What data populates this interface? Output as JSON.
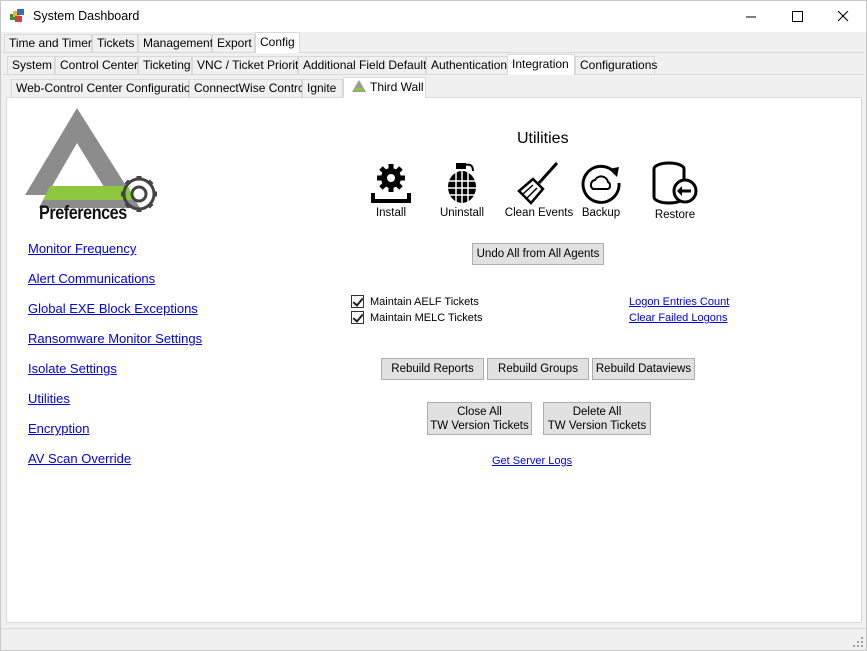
{
  "window": {
    "title": "System Dashboard",
    "controls": [
      "minimize",
      "maximize",
      "close"
    ]
  },
  "tabs_level1": [
    {
      "label": "Time and Timers",
      "active": false
    },
    {
      "label": "Tickets",
      "active": false
    },
    {
      "label": "Management",
      "active": false
    },
    {
      "label": "Export",
      "active": false
    },
    {
      "label": "Config",
      "active": true
    }
  ],
  "tabs_level2": [
    {
      "label": "System",
      "active": false
    },
    {
      "label": "Control Center",
      "active": false
    },
    {
      "label": "Ticketing",
      "active": false
    },
    {
      "label": "VNC / Ticket Priority",
      "active": false
    },
    {
      "label": "Additional Field Defaults",
      "active": false
    },
    {
      "label": "Authentication",
      "active": false
    },
    {
      "label": "Integration",
      "active": true
    },
    {
      "label": "Configurations",
      "active": false
    }
  ],
  "tabs_level3": [
    {
      "label": "Web-Control Center Configuration",
      "active": false
    },
    {
      "label": "ConnectWise Control",
      "active": false
    },
    {
      "label": "Ignite",
      "active": false
    },
    {
      "label": "Third Wall",
      "active": true,
      "icon": "third-wall-logo-icon"
    }
  ],
  "logo": {
    "text": "Preferences",
    "colors": {
      "gray": "#8c8c8c",
      "green": "#8dc63f"
    }
  },
  "nav_links": [
    "Monitor Frequency",
    "Alert Communications",
    "Global EXE Block Exceptions",
    "Ransomware Monitor Settings",
    "Isolate Settings",
    "Utilities",
    "Encryption",
    "AV Scan Override"
  ],
  "utilities": {
    "heading": "Utilities",
    "items": [
      {
        "label": "Install",
        "icon": "install-gear-icon"
      },
      {
        "label": "Uninstall",
        "icon": "grenade-icon"
      },
      {
        "label": "Clean Events",
        "icon": "broom-icon"
      },
      {
        "label": "Backup",
        "icon": "backup-cloud-icon"
      },
      {
        "label": "Restore",
        "icon": "restore-database-icon"
      }
    ],
    "undo_all": "Undo All from All Agents"
  },
  "checkboxes": [
    {
      "label": "Maintain AELF Tickets",
      "checked": true
    },
    {
      "label": "Maintain MELC Tickets",
      "checked": true
    }
  ],
  "links_right": {
    "logon_entries": "Logon Entries Count",
    "clear_failed": "Clear Failed Logons"
  },
  "rebuild_buttons": [
    "Rebuild Reports",
    "Rebuild Groups",
    "Rebuild Dataviews"
  ],
  "ticket_buttons": {
    "close_all": {
      "line1": "Close All",
      "line2": "TW Version Tickets"
    },
    "delete_all": {
      "line1": "Delete All",
      "line2": "TW Version Tickets"
    }
  },
  "server_logs": "Get Server Logs"
}
